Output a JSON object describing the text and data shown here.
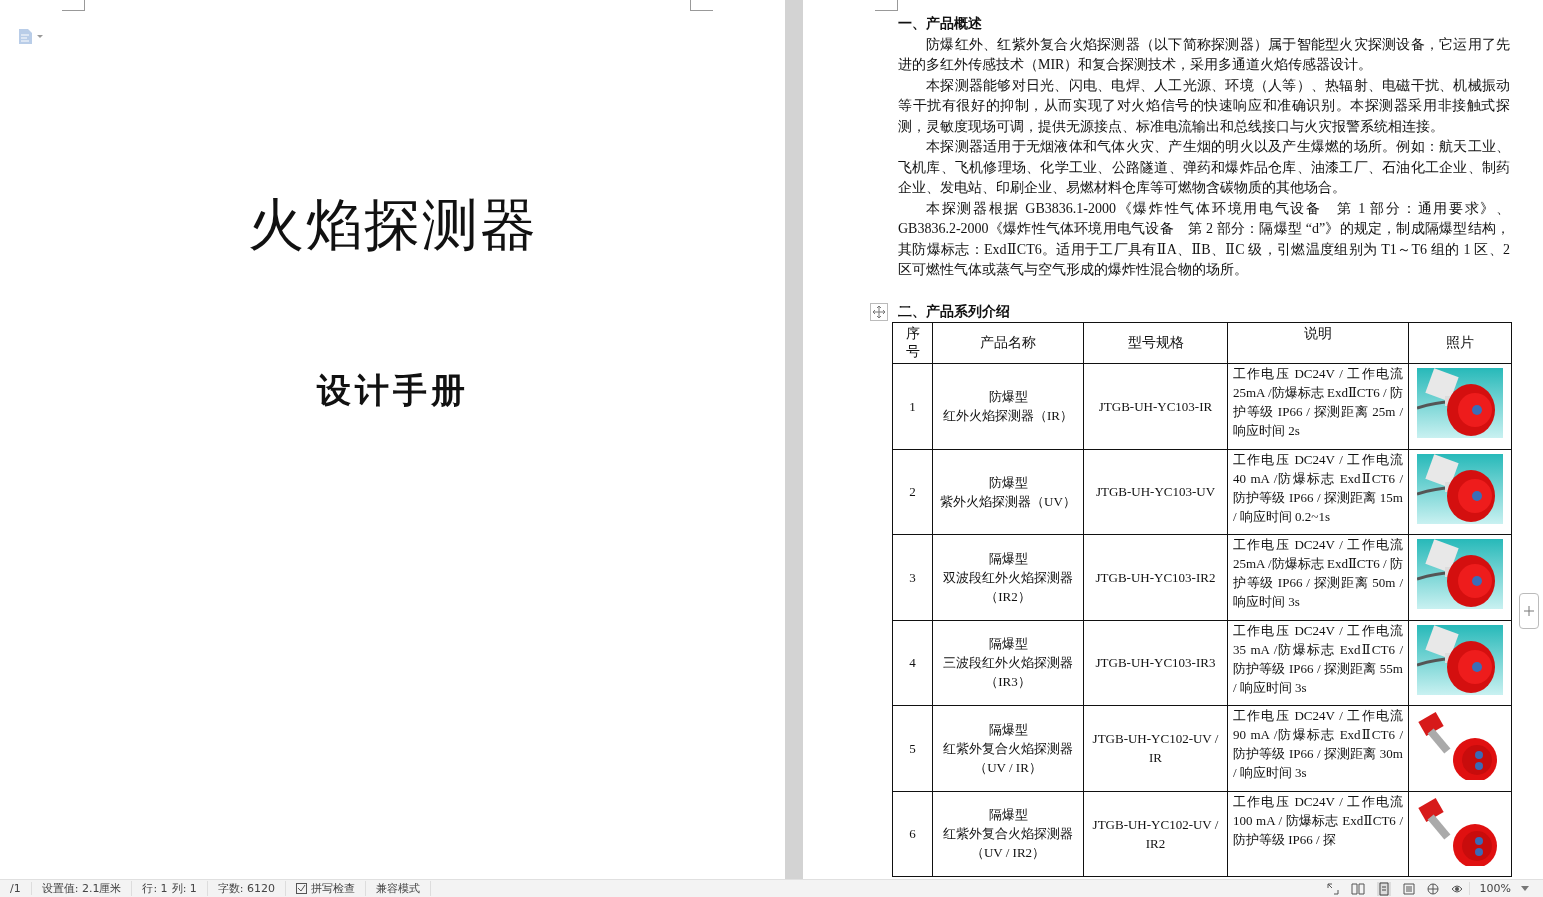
{
  "left_page": {
    "title": "火焰探测器",
    "subtitle": "设计手册"
  },
  "right_page": {
    "section_1": {
      "heading": "一、产品概述",
      "paragraphs": [
        "防爆红外、红紫外复合火焰探测器（以下简称探测器）属于智能型火灾探测设备，它运用了先进的多红外传感技术（MIR）和复合探测技术，采用多通道火焰传感器设计。",
        "本探测器能够对日光、闪电、电焊、人工光源、环境（人等）、热辐射、电磁干扰、机械振动等干扰有很好的抑制，从而实现了对火焰信号的快速响应和准确识别。本探测器采用非接触式探测，灵敏度现场可调，提供无源接点、标准电流输出和总线接口与火灾报警系统相连接。",
        "本探测器适用于无烟液体和气体火灾、产生烟的明火以及产生爆燃的场所。例如：航天工业、飞机库、飞机修理场、化学工业、公路隧道、弹药和爆炸品仓库、油漆工厂、石油化工企业、制药企业、发电站、印刷企业、易燃材料仓库等可燃物含碳物质的其他场合。",
        "本探测器根据 GB3836.1-2000《爆炸性气体环境用电气设备　第 1 部分：通用要求》、GB3836.2-2000《爆炸性气体环境用电气设备　第 2 部分：隔爆型 “d”》的规定，制成隔爆型结构，其防爆标志：ExdⅡCT6。适用于工厂具有ⅡA、ⅡB、ⅡC 级，引燃温度组别为 T1～T6 组的 1 区、2 区可燃性气体或蒸气与空气形成的爆炸性混合物的场所。"
      ]
    },
    "section_2": {
      "heading": "二、产品系列介绍",
      "table": {
        "columns": [
          "序号",
          "产品名称",
          "型号规格",
          "说明",
          "照片"
        ],
        "rows": [
          {
            "no": "1",
            "type": "防爆型",
            "name": "红外火焰探测器（IR）",
            "model": "JTGB-UH-YC103-IR",
            "description": "工作电压 DC24V / 工作电流 25mA /防爆标志 ExdⅡCT6 / 防护等级 IP66 / 探测距离 25m / 响应时间 2s"
          },
          {
            "no": "2",
            "type": "防爆型",
            "name": "紫外火焰探测器（UV）",
            "model": "JTGB-UH-YC103-UV",
            "description": "工作电压 DC24V / 工作电流 40 mA /防爆标志 ExdⅡCT6 / 防护等级 IP66 / 探测距离 15m / 响应时间 0.2~1s"
          },
          {
            "no": "3",
            "type": "隔爆型",
            "name": "双波段红外火焰探测器（IR2）",
            "model": "JTGB-UH-YC103-IR2",
            "description": "工作电压 DC24V / 工作电流 25mA /防爆标志 ExdⅡCT6 / 防护等级 IP66 / 探测距离 50m / 响应时间 3s"
          },
          {
            "no": "4",
            "type": "隔爆型",
            "name": "三波段红外火焰探测器（IR3）",
            "model": "JTGB-UH-YC103-IR3",
            "description": "工作电压 DC24V / 工作电流 35 mA /防爆标志 ExdⅡCT6 / 防护等级 IP66 / 探测距离 55m / 响应时间 3s"
          },
          {
            "no": "5",
            "type": "隔爆型",
            "name": "红紫外复合火焰探测器（UV / IR）",
            "model": "JTGB-UH-YC102-UV / IR",
            "description": "工作电压 DC24V / 工作电流 90 mA /防爆标志 ExdⅡCT6 / 防护等级 IP66 / 探测距离 30m / 响应时间 3s"
          },
          {
            "no": "6",
            "type": "隔爆型",
            "name": "红紫外复合火焰探测器（UV / IR2）",
            "model": "JTGB-UH-YC102-UV / IR2",
            "description": "工作电压 DC24V / 工作电流 100 mA / 防爆标志 ExdⅡCT6 / 防护等级 IP66 / 探"
          }
        ]
      }
    }
  },
  "status_bar": {
    "page": "/1",
    "setting": "设置值: 2.1厘米",
    "row": "行: 1",
    "column": "列: 1",
    "word_count": "字数: 6120",
    "spell_check": "拼写检查",
    "mode": "兼容模式",
    "zoom": "100%"
  }
}
